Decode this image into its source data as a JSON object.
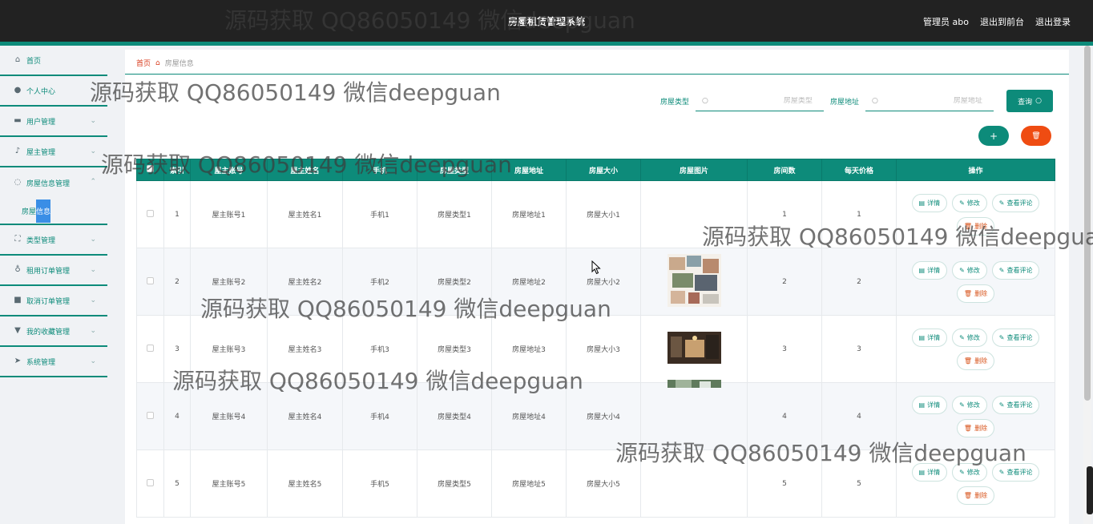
{
  "header": {
    "title": "房屋租赁管理系统",
    "links": [
      "管理员 abo",
      "退出到前台",
      "退出登录"
    ]
  },
  "sidebar": {
    "items": [
      {
        "label": "首页",
        "icon": "home-icon",
        "chevron": false
      },
      {
        "label": "个人中心",
        "icon": "user-icon",
        "chevron": false
      },
      {
        "label": "用户管理",
        "icon": "users-icon",
        "chevron": true
      },
      {
        "label": "屋主管理",
        "icon": "mic-icon",
        "chevron": true
      },
      {
        "label": "房屋信息管理",
        "icon": "power-icon",
        "chevron": true,
        "expanded": true
      }
    ],
    "submenu": {
      "label_a": "房屋",
      "label_b": "信息"
    },
    "items_after": [
      {
        "label": "类型管理",
        "icon": "expand-icon"
      },
      {
        "label": "租用订单管理",
        "icon": "bulb-icon"
      },
      {
        "label": "取消订单管理",
        "icon": "briefcase-icon"
      },
      {
        "label": "我的收藏管理",
        "icon": "thumb-icon"
      },
      {
        "label": "系统管理",
        "icon": "send-icon"
      }
    ]
  },
  "breadcrumb": {
    "home": "首页",
    "current": "房屋信息"
  },
  "search": {
    "type_label": "房屋类型",
    "type_placeholder": "房屋类型",
    "addr_label": "房屋地址",
    "addr_placeholder": "房屋地址",
    "button": "查询"
  },
  "actions": {
    "add": "+",
    "delete": "🗑"
  },
  "table": {
    "headers": [
      "",
      "索引",
      "屋主账号",
      "屋主姓名",
      "手机",
      "房屋类型",
      "房屋地址",
      "房屋大小",
      "房屋图片",
      "房间数",
      "每天价格",
      "操作"
    ],
    "rows": [
      {
        "idx": "1",
        "account": "屋主账号1",
        "name": "屋主姓名1",
        "phone": "手机1",
        "type": "房屋类型1",
        "addr": "房屋地址1",
        "size": "房屋大小1",
        "img": "none",
        "rooms": "1",
        "price": "1"
      },
      {
        "idx": "2",
        "account": "屋主账号2",
        "name": "屋主姓名2",
        "phone": "手机2",
        "type": "房屋类型2",
        "addr": "房屋地址2",
        "size": "房屋大小2",
        "img": "collage",
        "rooms": "2",
        "price": "2"
      },
      {
        "idx": "3",
        "account": "屋主账号3",
        "name": "屋主姓名3",
        "phone": "手机3",
        "type": "房屋类型3",
        "addr": "房屋地址3",
        "size": "房屋大小3",
        "img": "room",
        "rooms": "3",
        "price": "3"
      },
      {
        "idx": "4",
        "account": "屋主账号4",
        "name": "屋主姓名4",
        "phone": "手机4",
        "type": "房屋类型4",
        "addr": "房屋地址4",
        "size": "房屋大小4",
        "img": "partial",
        "rooms": "4",
        "price": "4"
      },
      {
        "idx": "5",
        "account": "屋主账号5",
        "name": "屋主姓名5",
        "phone": "手机5",
        "type": "房屋类型5",
        "addr": "房屋地址5",
        "size": "房屋大小5",
        "img": "none",
        "rooms": "5",
        "price": "5"
      }
    ],
    "ops": {
      "detail": "详情",
      "edit": "修改",
      "comments": "查看评论",
      "delete": "删除"
    }
  },
  "watermark": "源码获取 QQ86050149 微信deepguan",
  "colors": {
    "accent": "#0d8b7a",
    "danger": "#ef4c12",
    "header": "#222222"
  }
}
